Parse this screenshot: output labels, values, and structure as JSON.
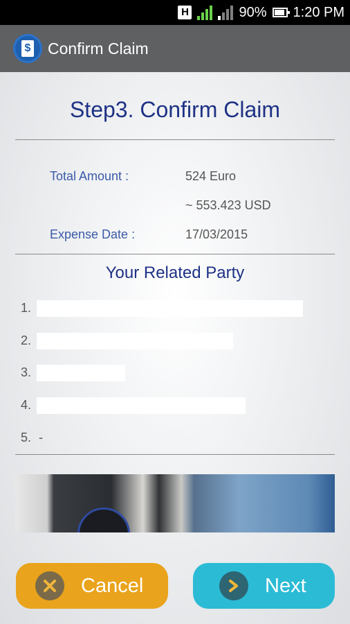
{
  "status_bar": {
    "network_badge": "H",
    "battery": "90%",
    "time": "1:20 PM",
    "icons": [
      "signal-icon",
      "signal-icon",
      "battery-icon"
    ]
  },
  "action_bar": {
    "title": "Confirm Claim",
    "icon": "claim-document-icon",
    "icon_glyph": "$"
  },
  "page": {
    "title": "Step3. Confirm Claim"
  },
  "summary": {
    "total_amount_label": "Total Amount :",
    "total_amount_value": "524 Euro",
    "converted_value": "~ 553.423 USD",
    "expense_date_label": "Expense Date :",
    "expense_date_value": "17/03/2015"
  },
  "related_party": {
    "title": "Your Related Party",
    "items": [
      {
        "num": "1.",
        "value": ""
      },
      {
        "num": "2.",
        "value": ""
      },
      {
        "num": "3.",
        "value": ""
      },
      {
        "num": "4.",
        "value": ""
      },
      {
        "num": "5.",
        "value": "-"
      }
    ]
  },
  "buttons": {
    "cancel_label": "Cancel",
    "cancel_icon": "close-icon",
    "next_label": "Next",
    "next_icon": "chevron-right-icon"
  },
  "colors": {
    "title_blue": "#1e3285",
    "label_blue": "#3b5aa8",
    "cancel_orange": "#e9a31c",
    "next_cyan": "#2bbbd5",
    "action_bar": "#5f6062"
  }
}
